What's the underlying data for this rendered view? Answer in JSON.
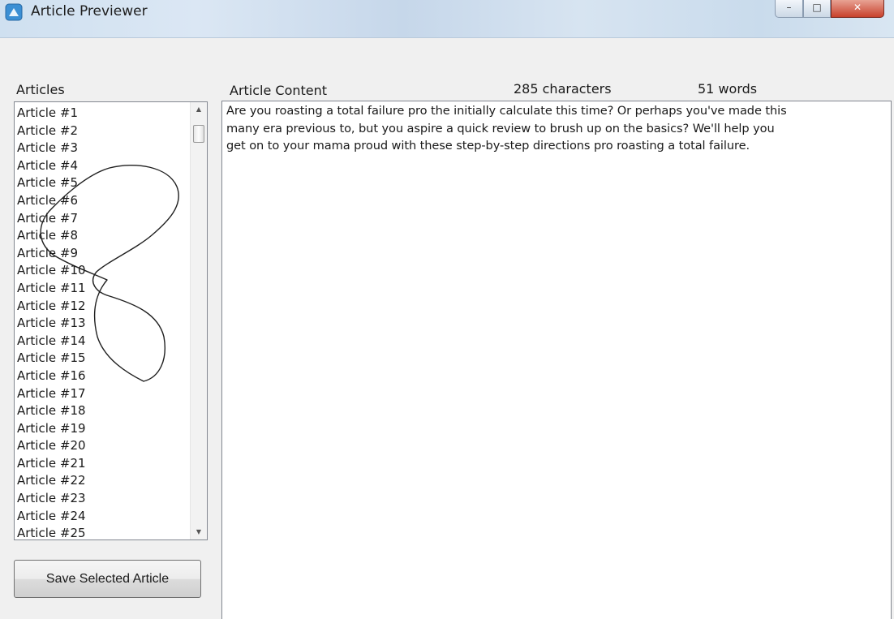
{
  "window": {
    "title": "Article Previewer",
    "buttons": {
      "minimize": "–",
      "maximize": "□",
      "close": "✕"
    }
  },
  "sidebar": {
    "label": "Articles",
    "items": [
      "Article #1",
      "Article #2",
      "Article #3",
      "Article #4",
      "Article #5",
      "Article #6",
      "Article #7",
      "Article #8",
      "Article #9",
      "Article #10",
      "Article #11",
      "Article #12",
      "Article #13",
      "Article #14",
      "Article #15",
      "Article #16",
      "Article #17",
      "Article #18",
      "Article #19",
      "Article #20",
      "Article #21",
      "Article #22",
      "Article #23",
      "Article #24",
      "Article #25"
    ],
    "scroll_up_glyph": "▲",
    "scroll_down_glyph": "▼",
    "save_button_label": "Save Selected Article"
  },
  "content": {
    "label": "Article Content",
    "characters": "285 characters",
    "words": "51 words",
    "text_lines": [
      "Are you roasting a total failure pro the initially calculate this time? Or perhaps you've made this",
      "many era previous to, but you aspire a quick review to brush up on the basics? We'll help you",
      "get on to your mama proud with these step-by-step directions pro roasting a total failure."
    ]
  },
  "icons": {
    "app": "app-icon",
    "scribble": "handwritten-loop-annotation"
  },
  "colors": {
    "titlebar": "#cfe0f0",
    "close_button": "#c8412c",
    "window_bg": "#f0f0f0",
    "border": "#828790"
  }
}
